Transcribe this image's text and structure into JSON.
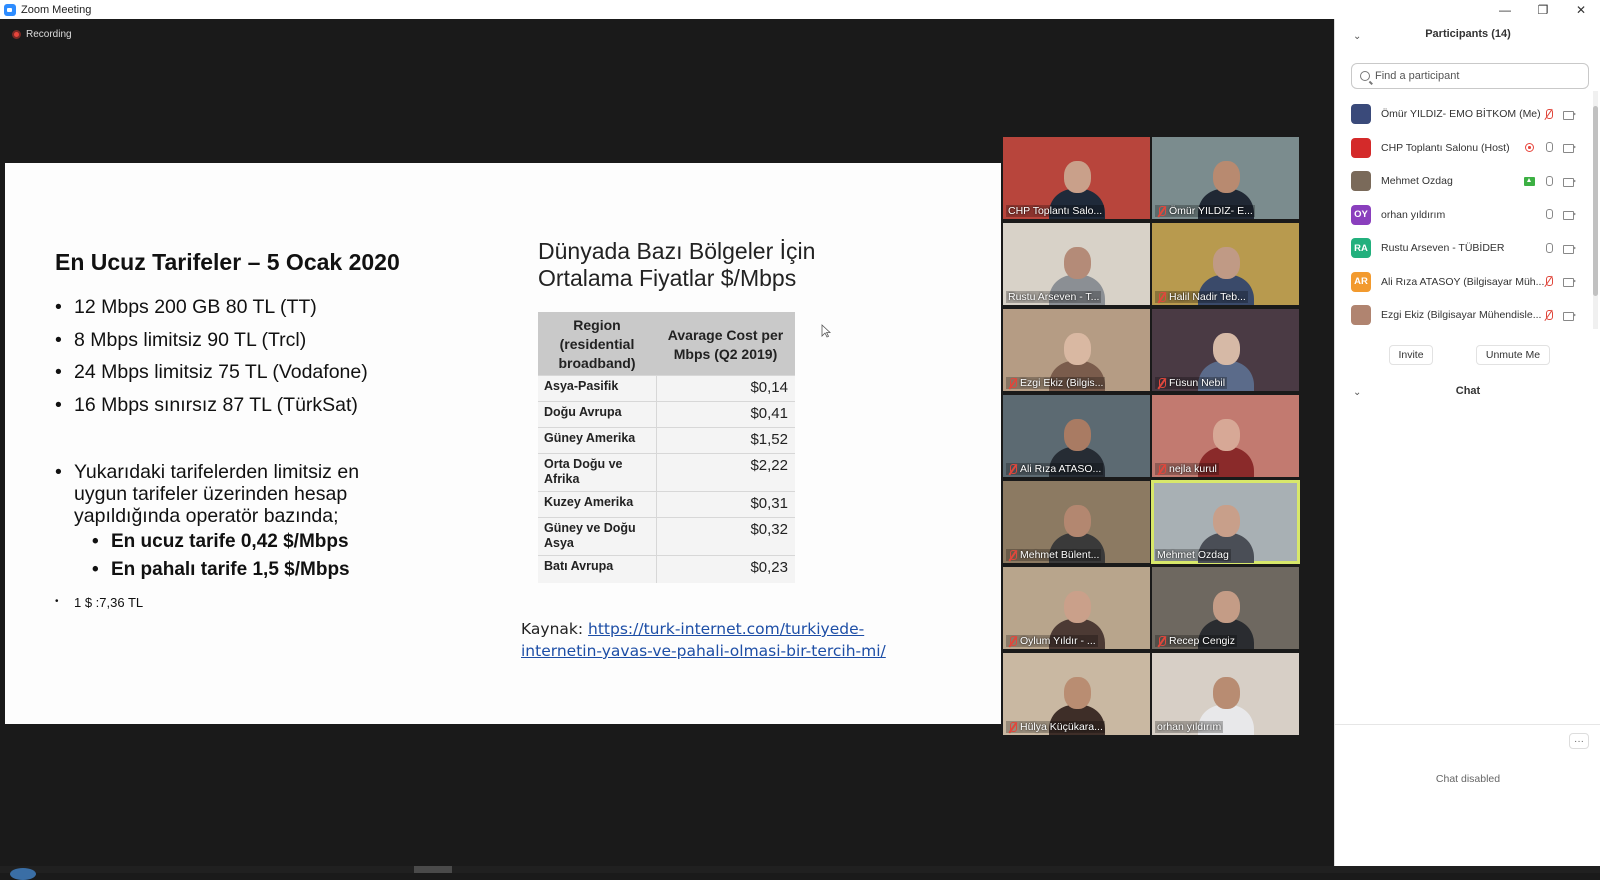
{
  "window": {
    "title": "Zoom Meeting",
    "recording_label": "Recording"
  },
  "slide": {
    "left_title": "En Ucuz Tarifeler – 5 Ocak 2020",
    "bullets": [
      "12 Mbps 200 GB 80 TL (TT)",
      "8 Mbps limitsiz 90 TL (Trcl)",
      "24 Mbps limitsiz 75 TL (Vodafone)",
      "16 Mbps sınırsız 87 TL (TürkSat)"
    ],
    "paragraph": "Yukarıdaki tarifelerden limitsiz en uygun tarifeler üzerinden hesap yapıldığında operatör bazında;",
    "sub_bullets": [
      "En ucuz tarife 0,42 $/Mbps",
      "En pahalı tarife 1,5 $/Mbps"
    ],
    "note": "1 $ :7,36 TL",
    "right_title_line1": "Dünyada Bazı Bölgeler İçin",
    "right_title_line2": "Ortalama Fiyatlar $/Mbps",
    "table": {
      "header_region": "Region (residential broadband)",
      "header_cost": "Avarage Cost per Mbps (Q2 2019)",
      "rows": [
        {
          "region": "Asya-Pasifik",
          "cost": "$0,14"
        },
        {
          "region": "Doğu Avrupa",
          "cost": "$0,41"
        },
        {
          "region": "Güney Amerika",
          "cost": "$1,52"
        },
        {
          "region": "Orta Doğu ve Afrika",
          "cost": "$2,22"
        },
        {
          "region": "Kuzey Amerika",
          "cost": "$0,31"
        },
        {
          "region": "Güney ve Doğu Asya",
          "cost": "$0,32"
        },
        {
          "region": "Batı Avrupa",
          "cost": "$0,23"
        }
      ]
    },
    "source_label": "Kaynak:",
    "source_link_line1": "https://turk-internet.com/turkiyede-",
    "source_link_line2": "internetin-yavas-ve-pahali-olmasi-bir-tercih-mi/"
  },
  "video_tiles": [
    {
      "name": "CHP Toplantı Salo...",
      "muted": false,
      "bg": "#b8453c",
      "skin": "#c9a08a",
      "shirt": "#1f2a3a"
    },
    {
      "name": "Ömür YILDIZ- E...",
      "muted": true,
      "bg": "#7b8c8e",
      "skin": "#b88a70",
      "shirt": "#202834"
    },
    {
      "name": "Rustu Arseven - T...",
      "muted": false,
      "bg": "#d8d2c8",
      "skin": "#b48b78",
      "shirt": "#8b8f94"
    },
    {
      "name": "Halil Nadir Teb...",
      "muted": true,
      "bg": "#b89a4e",
      "skin": "#c09a85",
      "shirt": "#3a4a6a"
    },
    {
      "name": "Ezgi Ekiz (Bilgis...",
      "muted": true,
      "bg": "#b59c84",
      "skin": "#d9b8a2",
      "shirt": "#7a5c4c"
    },
    {
      "name": "Füsun Nebil",
      "muted": true,
      "bg": "#4a3a44",
      "skin": "#d6b9a6",
      "shirt": "#5b6b8a"
    },
    {
      "name": "Ali Rıza ATASO...",
      "muted": true,
      "bg": "#5c6a72",
      "skin": "#a97b63",
      "shirt": "#262c34"
    },
    {
      "name": "nejla kurul",
      "muted": true,
      "bg": "#c27a70",
      "skin": "#d7a896",
      "shirt": "#8a2a2a"
    },
    {
      "name": "Mehmet Bülent...",
      "muted": true,
      "bg": "#8c7a62",
      "skin": "#b38770",
      "shirt": "#3a3a3a"
    },
    {
      "name": "Mehmet Ozdag",
      "muted": false,
      "active": true,
      "bg": "#a8b0b4",
      "skin": "#c89f8a",
      "shirt": "#4a4e56"
    },
    {
      "name": "Oylum Yıldır - ...",
      "muted": true,
      "bg": "#b8a58c",
      "skin": "#caa08a",
      "shirt": "#4c3a34"
    },
    {
      "name": "Recep Cengiz",
      "muted": true,
      "bg": "#6e6860",
      "skin": "#c49c86",
      "shirt": "#2a2c30"
    },
    {
      "name": "Hülya Küçükara...",
      "muted": true,
      "bg": "#c9b8a2",
      "skin": "#b98d72",
      "shirt": "#3e2e28"
    },
    {
      "name": "orhan yıldırım",
      "muted": false,
      "bg": "#d7cfc6",
      "skin": "#b88c72",
      "shirt": "#e8e8ea"
    }
  ],
  "panel": {
    "participants_title": "Participants (14)",
    "search_placeholder": "Find a participant",
    "participants": [
      {
        "name": "Ömür YILDIZ- EMO BİTKOM (Me)",
        "avatar": "img",
        "avatar_color": "#3a4a7a",
        "status": "",
        "mic": "muted"
      },
      {
        "name": "CHP Toplantı Salonu (Host)",
        "avatar": "img",
        "avatar_color": "#d42a2a",
        "status": "rec",
        "mic": "on"
      },
      {
        "name": "Mehmet Ozdag",
        "avatar": "img",
        "avatar_color": "#7a6a5a",
        "status": "share",
        "mic": "on"
      },
      {
        "name": "orhan yıldırım",
        "avatar": "OY",
        "avatar_color": "#8a3fbd",
        "status": "",
        "mic": "on"
      },
      {
        "name": "Rustu Arseven - TÜBİDER",
        "avatar": "RA",
        "avatar_color": "#22b07d",
        "status": "",
        "mic": "on"
      },
      {
        "name": "Ali Rıza ATASOY (Bilgisayar Müh...",
        "avatar": "AR",
        "avatar_color": "#f29a2e",
        "status": "",
        "mic": "muted"
      },
      {
        "name": "Ezgi Ekiz (Bilgisayar Mühendisle...",
        "avatar": "img",
        "avatar_color": "#b08470",
        "status": "",
        "mic": "muted"
      }
    ],
    "invite_label": "Invite",
    "unmute_label": "Unmute Me",
    "chat_title": "Chat",
    "chat_more_label": "···",
    "chat_disabled_label": "Chat disabled"
  }
}
